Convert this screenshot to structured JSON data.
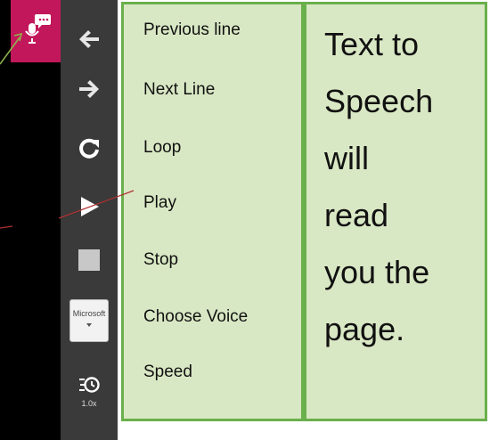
{
  "toolbar": {
    "voice_select": "Microsoft",
    "speed_value": "1.0x"
  },
  "labels": [
    "Previous line",
    "Next Line",
    "Loop",
    "Play",
    "Stop",
    "Choose Voice",
    "Speed"
  ],
  "description": [
    "Text to",
    "Speech",
    "will",
    "read",
    "you the",
    "page."
  ],
  "colors": {
    "tts_tile": "#c2185b",
    "toolbar": "#3a3a3a",
    "panel_fill": "#d9e8c4",
    "panel_border": "#6ab04c",
    "annotation_line": "#b03030"
  }
}
